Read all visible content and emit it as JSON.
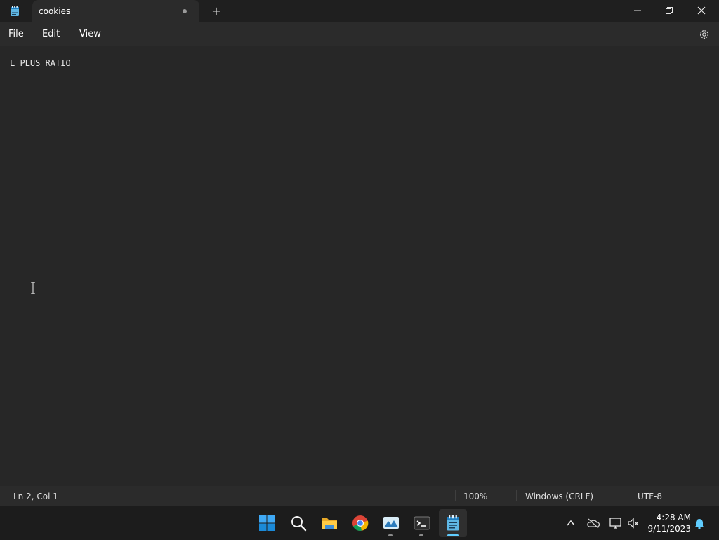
{
  "window": {
    "tab_title": "cookies",
    "new_tab_symbol": "+"
  },
  "menu": {
    "file": "File",
    "edit": "Edit",
    "view": "View"
  },
  "editor": {
    "content": "L PLUS RATIO"
  },
  "status": {
    "position": "Ln 2, Col 1",
    "zoom": "100%",
    "line_ending": "Windows (CRLF)",
    "encoding": "UTF-8"
  },
  "taskbar": {
    "time": "4:28 AM",
    "date": "9/11/2023"
  },
  "icons": {
    "app": "notepad-icon",
    "settings": "gear-icon",
    "minimize": "minimize-icon",
    "maximize": "restore-icon",
    "close": "close-icon"
  },
  "colors": {
    "accent": "#60cdff",
    "background": "#272727"
  }
}
